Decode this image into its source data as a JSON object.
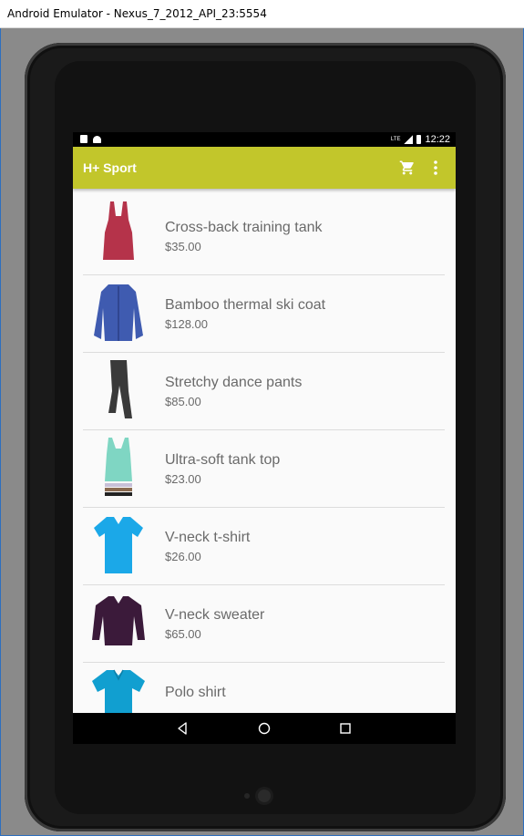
{
  "window": {
    "title": "Android Emulator - Nexus_7_2012_API_23:5554"
  },
  "status_bar": {
    "time": "12:22",
    "network": "LTE"
  },
  "app_bar": {
    "title": "H+ Sport"
  },
  "products": [
    {
      "name": "Cross-back training tank",
      "price": "$35.00",
      "icon": "red-tank-top-icon",
      "color": "#b5334a"
    },
    {
      "name": "Bamboo thermal ski coat",
      "price": "$128.00",
      "icon": "blue-puffer-coat-icon",
      "color": "#3f5bb0"
    },
    {
      "name": "Stretchy dance pants",
      "price": "$85.00",
      "icon": "gray-pants-icon",
      "color": "#3a3a3a"
    },
    {
      "name": "Ultra-soft tank top",
      "price": "$23.00",
      "icon": "mint-tank-top-icon",
      "color": "#7fd6c3"
    },
    {
      "name": "V-neck t-shirt",
      "price": "$26.00",
      "icon": "blue-tshirt-icon",
      "color": "#1ba8e8"
    },
    {
      "name": "V-neck sweater",
      "price": "$65.00",
      "icon": "purple-sweater-icon",
      "color": "#3b1a3a"
    },
    {
      "name": "Polo shirt",
      "price": "",
      "icon": "blue-polo-shirt-icon",
      "color": "#119fd0"
    }
  ],
  "colors": {
    "app_bar": "#c2c62b",
    "text": "#6a6a6a",
    "background": "#fafafa"
  }
}
